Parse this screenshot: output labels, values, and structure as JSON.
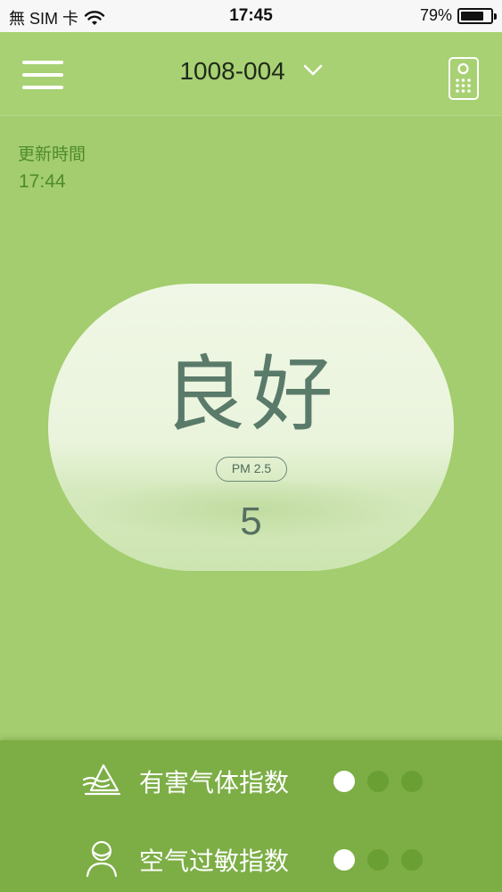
{
  "status_bar": {
    "carrier": "無 SIM 卡",
    "time": "17:45",
    "battery_percent": "79%",
    "battery_level": 0.79
  },
  "header": {
    "device_name": "1008-004",
    "menu_icon": "hamburger-menu-icon",
    "remote_icon": "remote-control-icon",
    "dropdown_icon": "chevron-down-icon"
  },
  "update": {
    "label": "更新時間",
    "time": "17:44"
  },
  "air_quality": {
    "status": "良好",
    "pm_label": "PM 2.5",
    "pm_value": "5"
  },
  "indices": [
    {
      "label": "有害气体指数",
      "icon": "gas-wind-icon",
      "active_dot": 0,
      "dot_count": 3
    },
    {
      "label": "空气过敏指数",
      "icon": "mask-person-icon",
      "active_dot": 0,
      "dot_count": 3
    }
  ],
  "colors": {
    "background": "#a3cd6e",
    "header": "#a8d173",
    "bottom_panel": "#7cae45",
    "text_green": "#4f8a2c"
  }
}
